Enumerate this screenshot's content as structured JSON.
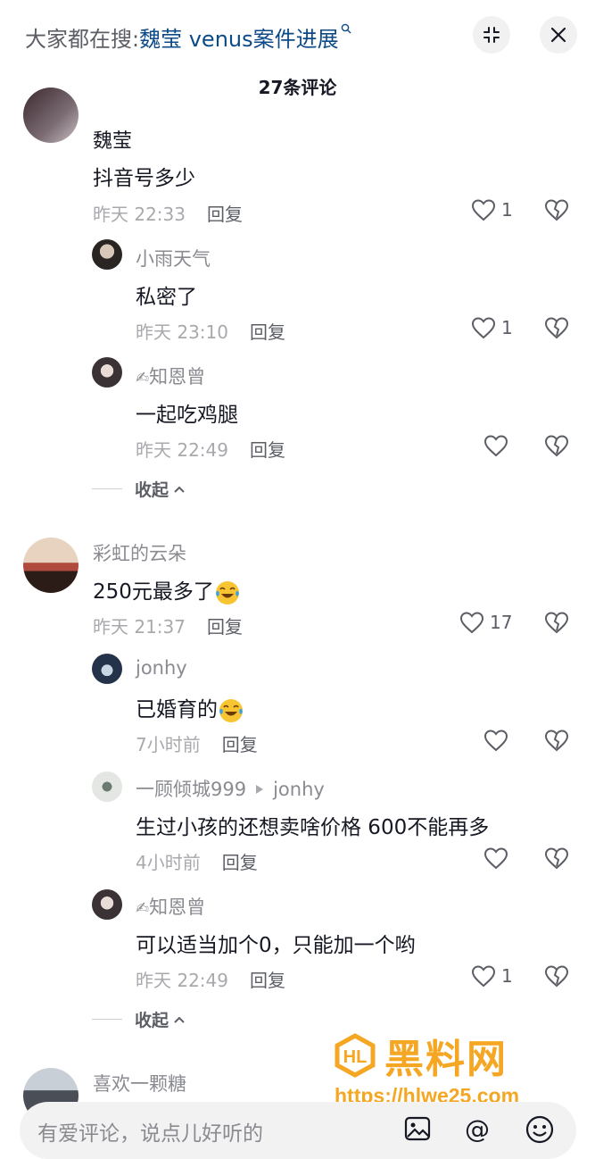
{
  "header": {
    "search_prefix": "大家都在搜:",
    "search_keyword": "魏莹 venus案件进展",
    "comment_count": "27条评论"
  },
  "comments": [
    {
      "user": "魏莹",
      "text": "抖音号多少",
      "time": "昨天 22:33",
      "reply": "回复",
      "likes": "1"
    },
    {
      "user": "小雨天气",
      "text": "私密了",
      "time": "昨天 23:10",
      "reply": "回复",
      "likes": "1"
    },
    {
      "user": "知恩曾",
      "text": "一起吃鸡腿",
      "time": "昨天 22:49",
      "reply": "回复",
      "likes": ""
    },
    {
      "user": "彩虹的云朵",
      "text": "250元最多了",
      "time": "昨天 21:37",
      "reply": "回复",
      "likes": "17"
    },
    {
      "user": "jonhy",
      "text": "已婚育的",
      "time": "7小时前",
      "reply": "回复",
      "likes": ""
    },
    {
      "user": "一顾倾城999",
      "reply_to": "jonhy",
      "text": "生过小孩的还想卖啥价格 600不能再多",
      "time": "4小时前",
      "reply": "回复",
      "likes": ""
    },
    {
      "user": "知恩曾",
      "text": "可以适当加个0，只能加一个哟",
      "time": "昨天 22:49",
      "reply": "回复",
      "likes": "1"
    },
    {
      "user": "喜欢一颗糖"
    }
  ],
  "collapse_label": "收起",
  "watermark": {
    "brand": "黑料网",
    "url": "https://hlwe25.com"
  },
  "input": {
    "placeholder": "有爱评论，说点儿好听的"
  },
  "colors": {
    "keyword": "#0c4a88",
    "watermark": "#f5a623",
    "muted": "#a8a9ad"
  }
}
